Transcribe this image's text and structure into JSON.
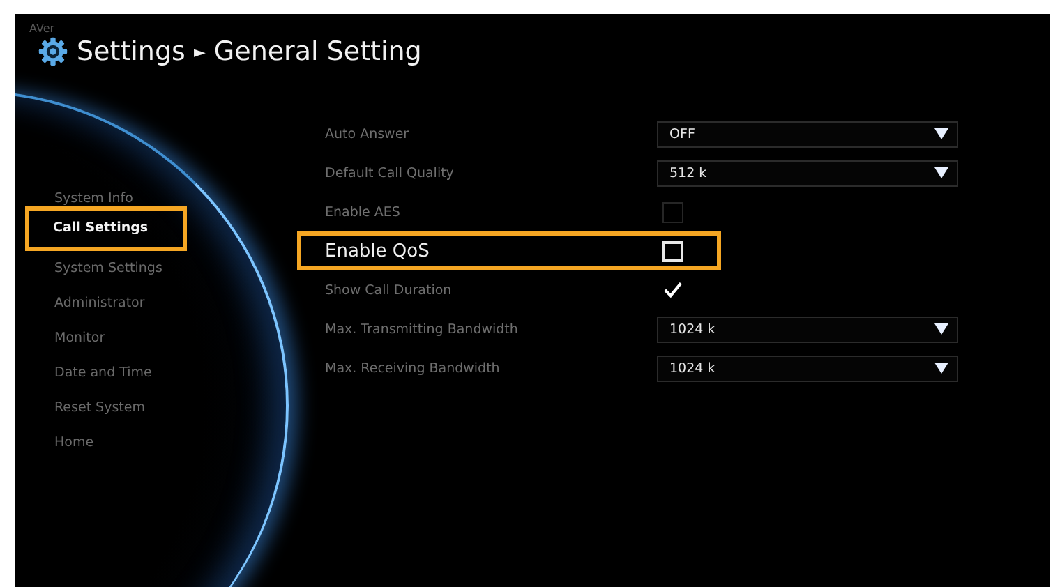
{
  "logo": "AVer",
  "header": {
    "title": "Settings",
    "separator": "►",
    "subtitle": "General Setting"
  },
  "sidebar": {
    "items": [
      {
        "label": "System Info",
        "selected": false,
        "highlighted": false
      },
      {
        "label": "Call Settings",
        "selected": true,
        "highlighted": true
      },
      {
        "label": "System Settings",
        "selected": false,
        "highlighted": false
      },
      {
        "label": "Administrator",
        "selected": false,
        "highlighted": false
      },
      {
        "label": "Monitor",
        "selected": false,
        "highlighted": false
      },
      {
        "label": "Date and Time",
        "selected": false,
        "highlighted": false
      },
      {
        "label": "Reset System",
        "selected": false,
        "highlighted": false
      },
      {
        "label": "Home",
        "selected": false,
        "highlighted": false
      }
    ]
  },
  "settings": [
    {
      "kind": "select",
      "label": "Auto Answer",
      "value": "OFF",
      "highlighted": false
    },
    {
      "kind": "select",
      "label": "Default Call Quality",
      "value": "512 k",
      "highlighted": false
    },
    {
      "kind": "checkbox",
      "label": "Enable AES",
      "checked": false,
      "disabled": true,
      "highlighted": false
    },
    {
      "kind": "checkbox",
      "label": "Enable QoS",
      "checked": false,
      "disabled": false,
      "highlighted": true
    },
    {
      "kind": "checkbox",
      "label": "Show Call Duration",
      "checked": true,
      "disabled": false,
      "highlighted": false
    },
    {
      "kind": "select",
      "label": "Max. Transmitting Bandwidth",
      "value": "1024 k",
      "highlighted": false
    },
    {
      "kind": "select",
      "label": "Max. Receiving Bandwidth",
      "value": "1024 k",
      "highlighted": false
    }
  ]
}
